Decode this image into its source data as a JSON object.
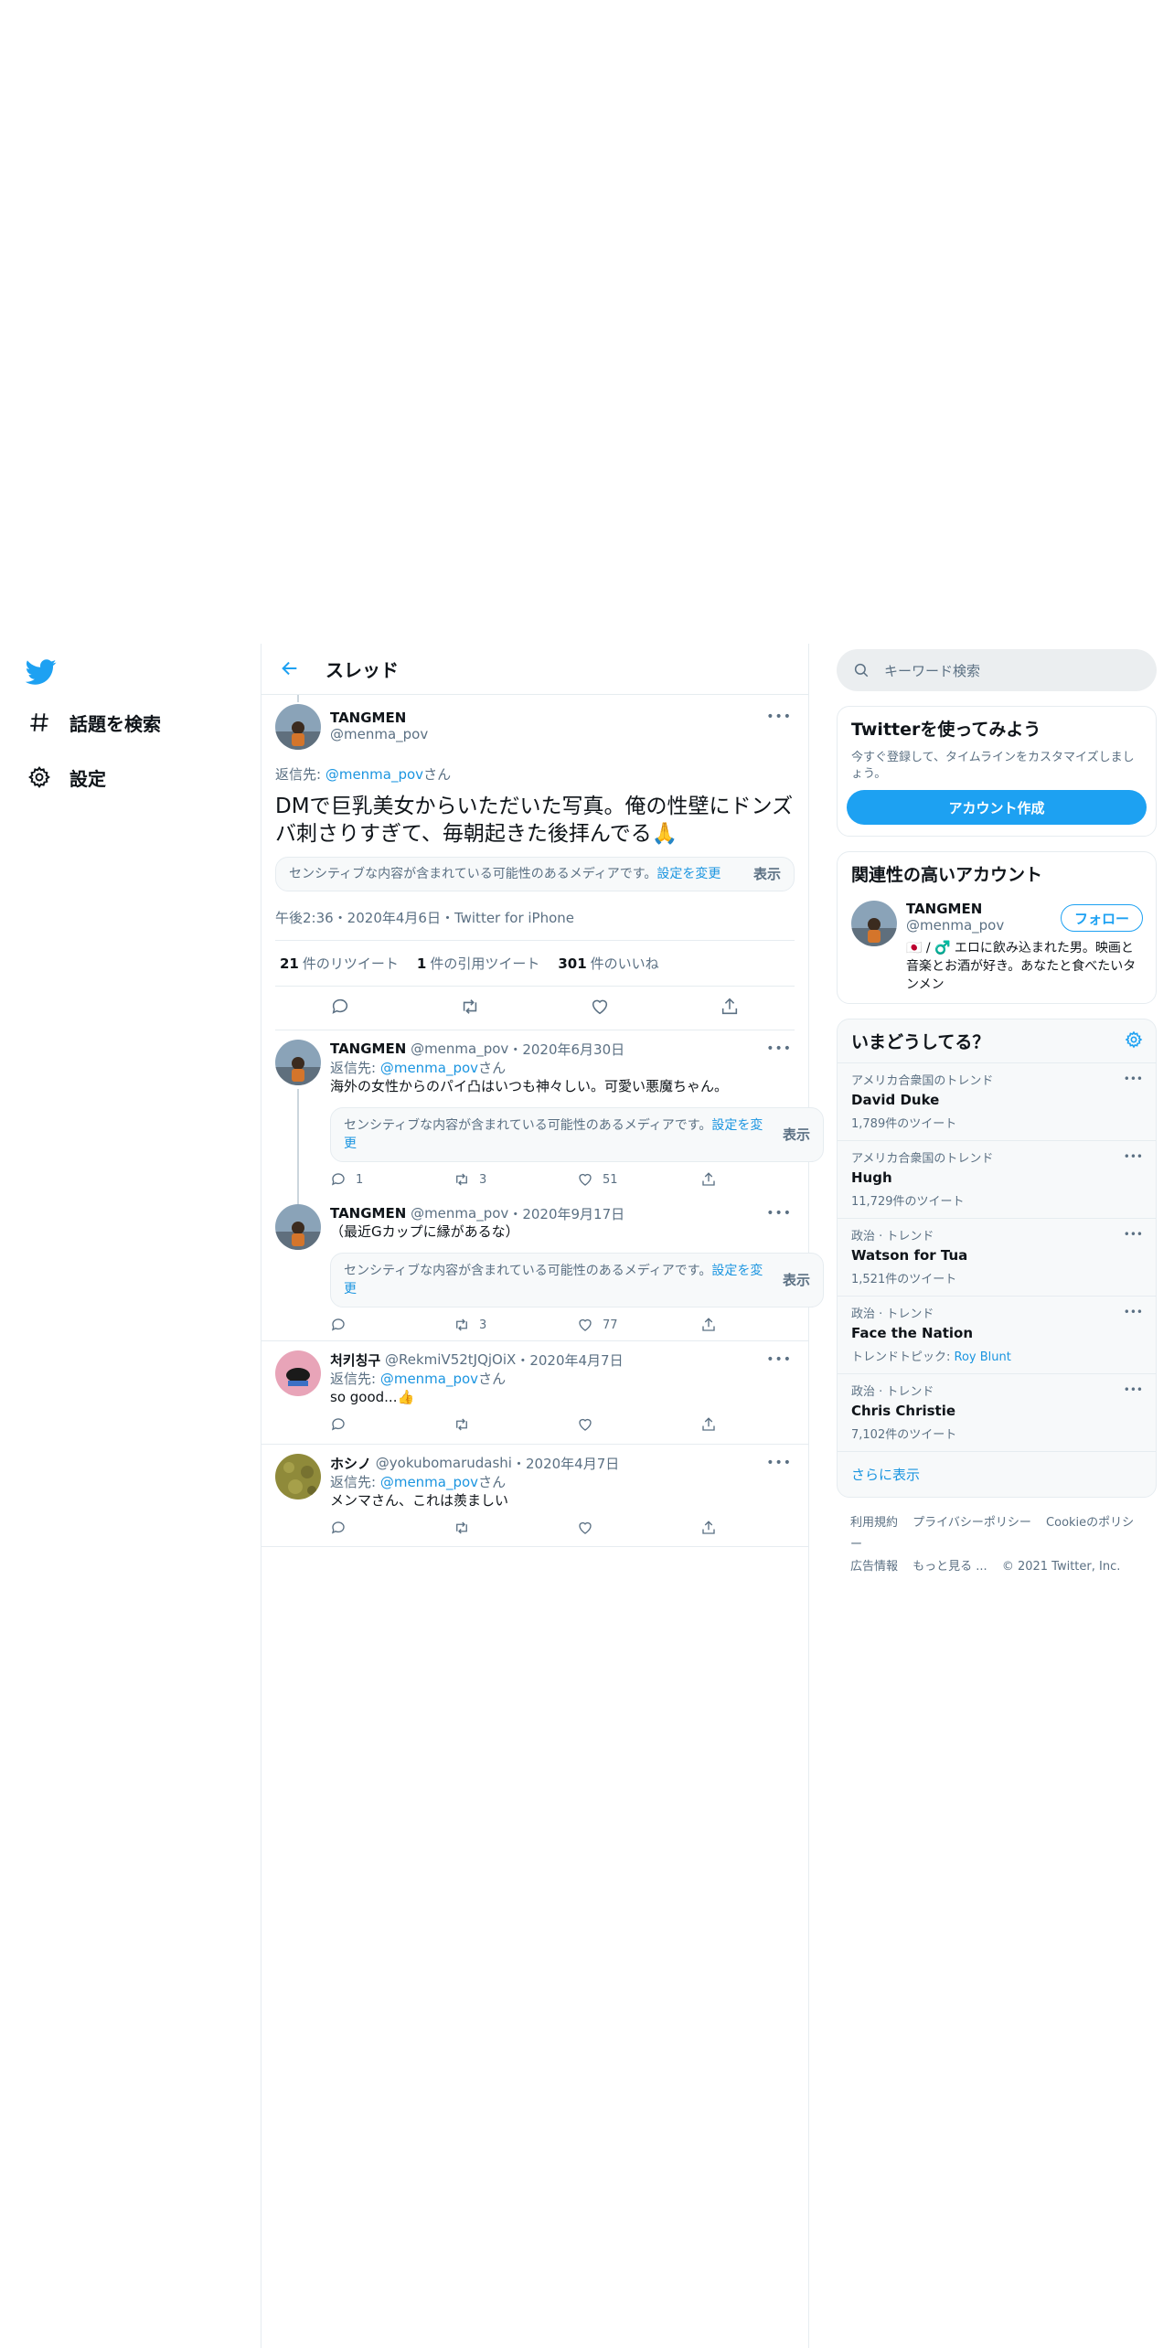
{
  "nav": {
    "explore_label": "話題を検索",
    "settings_label": "設定"
  },
  "header": {
    "title": "スレッド"
  },
  "focal_tweet": {
    "name": "TANGMEN",
    "handle": "@menma_pov",
    "reply_prefix": "返信先: ",
    "reply_handle": "@menma_pov",
    "reply_suffix": "さん",
    "text": "DMで巨乳美女からいただいた写真。俺の性壁にドンズバ刺さりすぎて、毎朝起きた後拝んでる🙏",
    "sensitive_text": "センシティブな内容が含まれている可能性のあるメディアです。",
    "sensitive_link": "設定を変更",
    "show_label": "表示",
    "meta": "午後2:36・2020年4月6日・Twitter for iPhone",
    "retweets_num": "21",
    "retweets_label": "件のリツイート",
    "quotes_num": "1",
    "quotes_label": "件の引用ツイート",
    "likes_num": "301",
    "likes_label": "件のいいね"
  },
  "replies": [
    {
      "name": "TANGMEN",
      "handle": "@menma_pov",
      "dot": "・",
      "date": "2020年6月30日",
      "reply_prefix": "返信先: ",
      "reply_handle": "@menma_pov",
      "reply_suffix": "さん",
      "text": "海外の女性からのパイ凸はいつも神々しい。可愛い悪魔ちゃん。",
      "sensitive_text": "センシティブな内容が含まれている可能性のあるメディアです。",
      "sensitive_link": "設定を変更",
      "show_label": "表示",
      "reply_count": "1",
      "retweet_count": "3",
      "like_count": "51"
    },
    {
      "name": "TANGMEN",
      "handle": "@menma_pov",
      "dot": "・",
      "date": "2020年9月17日",
      "text": "（最近Gカップに縁があるな）",
      "sensitive_text": "センシティブな内容が含まれている可能性のあるメディアです。",
      "sensitive_link": "設定を変更",
      "show_label": "表示",
      "reply_count": "",
      "retweet_count": "3",
      "like_count": "77"
    },
    {
      "name": "처키칭구",
      "handle": "@RekmiV52tJQjOiX",
      "dot": "・",
      "date": "2020年4月7日",
      "reply_prefix": "返信先: ",
      "reply_handle": "@menma_pov",
      "reply_suffix": "さん",
      "text": "so good...👍"
    },
    {
      "name": "ホシノ",
      "handle": "@yokubomarudashi",
      "dot": "・",
      "date": "2020年4月7日",
      "reply_prefix": "返信先: ",
      "reply_handle": "@menma_pov",
      "reply_suffix": "さん",
      "text": "メンマさん、これは羨ましい"
    }
  ],
  "search": {
    "placeholder": "キーワード検索"
  },
  "signup": {
    "title": "Twitterを使ってみよう",
    "desc": "今すぐ登録して、タイムラインをカスタマイズしましょう。",
    "button": "アカウント作成"
  },
  "related": {
    "title": "関連性の高いアカウント",
    "name": "TANGMEN",
    "handle": "@menma_pov",
    "follow": "フォロー",
    "bio": "🇯🇵 / ♂️ エロに飲み込まれた男。映画と音楽とお酒が好き。あなたと食べたいタンメン"
  },
  "trends": {
    "title": "いまどうしてる？",
    "items": [
      {
        "context": "アメリカ合衆国のトレンド",
        "name": "David Duke",
        "count": "1,789件のツイート"
      },
      {
        "context": "アメリカ合衆国のトレンド",
        "name": "Hugh",
        "count": "11,729件のツイート"
      },
      {
        "context": "政治 · トレンド",
        "name": "Watson for Tua",
        "count": "1,521件のツイート"
      },
      {
        "context": "政治 · トレンド",
        "name": "Face the Nation",
        "topic_prefix": "トレンドトピック: ",
        "topic": "Roy Blunt"
      },
      {
        "context": "政治 · トレンド",
        "name": "Chris Christie",
        "count": "7,102件のツイート"
      }
    ],
    "show_more": "さらに表示"
  },
  "footer": {
    "terms": "利用規約",
    "privacy": "プライバシーポリシー",
    "cookie": "Cookieのポリシー",
    "ads": "広告情報",
    "more": "もっと見る ...",
    "copyright": "© 2021 Twitter, Inc."
  },
  "colors": {
    "accent": "#1da1f2",
    "link": "#1b95e0",
    "muted": "#5b7083",
    "border": "#e6ecf0"
  }
}
